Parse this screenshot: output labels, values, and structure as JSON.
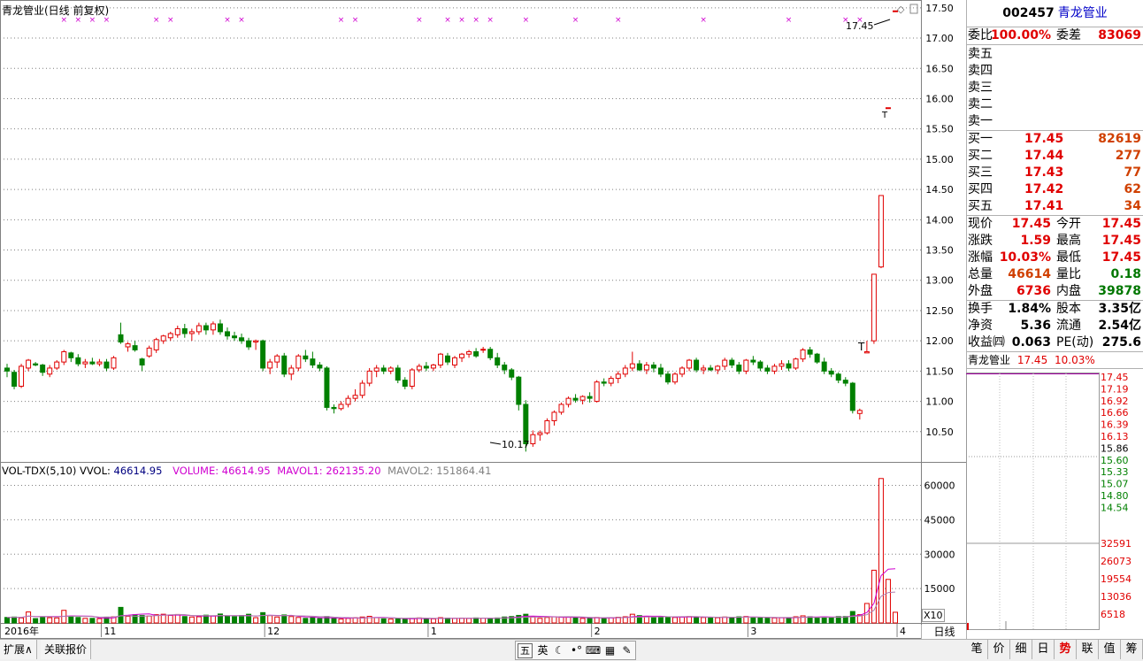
{
  "header": {
    "main_title": "青龙管业(日线 前复权)"
  },
  "volume_header": {
    "indicator": "VOL-TDX(5,10)",
    "vvol_label": "VVOL:",
    "vvol_value": "46614.95",
    "volume_text": "VOLUME: 46614.95",
    "mavol1_text": "MAVOL1: 262135.20",
    "mavol2_text": "MAVOL2: 151864.41"
  },
  "price_axis": {
    "ticks": [
      "17.50",
      "17.00",
      "16.50",
      "16.00",
      "15.50",
      "15.00",
      "14.50",
      "14.00",
      "13.50",
      "13.00",
      "12.50",
      "12.00",
      "11.50",
      "11.00",
      "10.50"
    ]
  },
  "vol_axis": {
    "ticks": [
      "60000",
      "45000",
      "30000",
      "15000"
    ],
    "unit": "X10"
  },
  "date_axis": {
    "labels": [
      "2016年",
      "11",
      "12",
      "1",
      "2",
      "3",
      "4"
    ]
  },
  "annotations": {
    "high": "17.45",
    "low": "10.17"
  },
  "colors": {
    "up": "#e00000",
    "down": "#008000",
    "ma1": "#d000d0",
    "ma2": "#b080b0",
    "grid": "#7f7f7f"
  },
  "chart_data": {
    "type": "candlestick",
    "price_ylim": [
      10.0,
      17.6
    ],
    "volume_ylim": [
      0,
      66000
    ],
    "candles": [
      [
        11.55,
        11.62,
        11.4,
        11.5,
        2400
      ],
      [
        11.48,
        11.52,
        11.2,
        11.25,
        2600
      ],
      [
        11.25,
        11.62,
        11.22,
        11.58,
        2200
      ],
      [
        11.55,
        11.7,
        11.5,
        11.68,
        4800
      ],
      [
        11.62,
        11.65,
        11.58,
        11.6,
        1900
      ],
      [
        11.6,
        11.62,
        11.42,
        11.48,
        2600
      ],
      [
        11.45,
        11.6,
        11.4,
        11.55,
        2300
      ],
      [
        11.55,
        11.68,
        11.52,
        11.65,
        2200
      ],
      [
        11.65,
        11.85,
        11.6,
        11.82,
        5500
      ],
      [
        11.8,
        11.82,
        11.65,
        11.72,
        2800
      ],
      [
        11.72,
        11.78,
        11.58,
        11.62,
        2400
      ],
      [
        11.62,
        11.7,
        11.55,
        11.65,
        2000
      ],
      [
        11.65,
        11.72,
        11.6,
        11.62,
        2000
      ],
      [
        11.62,
        11.7,
        11.58,
        11.65,
        1900
      ],
      [
        11.65,
        11.7,
        11.5,
        11.55,
        2400
      ],
      [
        11.55,
        11.75,
        11.52,
        11.72,
        2700
      ],
      [
        12.1,
        12.3,
        11.95,
        11.98,
        6800
      ],
      [
        11.9,
        11.98,
        11.82,
        11.95,
        2900
      ],
      [
        11.92,
        12.0,
        11.82,
        11.85,
        3600
      ],
      [
        11.7,
        11.72,
        11.5,
        11.6,
        3300
      ],
      [
        11.75,
        11.92,
        11.72,
        11.88,
        3000
      ],
      [
        11.85,
        12.05,
        11.8,
        12.02,
        3600
      ],
      [
        12.0,
        12.1,
        11.95,
        12.08,
        3800
      ],
      [
        12.05,
        12.15,
        12.0,
        12.12,
        3300
      ],
      [
        12.1,
        12.25,
        12.05,
        12.2,
        3700
      ],
      [
        12.2,
        12.28,
        12.05,
        12.12,
        2800
      ],
      [
        12.12,
        12.2,
        12.0,
        12.15,
        2600
      ],
      [
        12.15,
        12.3,
        12.1,
        12.25,
        2700
      ],
      [
        12.25,
        12.3,
        12.1,
        12.18,
        3400
      ],
      [
        12.18,
        12.32,
        12.1,
        12.28,
        3100
      ],
      [
        12.28,
        12.35,
        12.1,
        12.15,
        3900
      ],
      [
        12.15,
        12.22,
        12.02,
        12.08,
        2900
      ],
      [
        12.08,
        12.15,
        12.0,
        12.05,
        2700
      ],
      [
        12.05,
        12.12,
        11.95,
        12.0,
        3200
      ],
      [
        12.0,
        12.05,
        11.85,
        11.9,
        3800
      ],
      [
        11.98,
        12.02,
        11.85,
        12.0,
        2300
      ],
      [
        12.0,
        12.02,
        11.5,
        11.55,
        4500
      ],
      [
        11.55,
        11.7,
        11.45,
        11.65,
        3200
      ],
      [
        11.65,
        11.78,
        11.55,
        11.75,
        2600
      ],
      [
        11.75,
        11.8,
        11.4,
        11.45,
        3500
      ],
      [
        11.45,
        11.6,
        11.35,
        11.55,
        2800
      ],
      [
        11.55,
        11.78,
        11.5,
        11.75,
        2400
      ],
      [
        11.75,
        11.85,
        11.65,
        11.7,
        2000
      ],
      [
        11.7,
        11.82,
        11.55,
        11.6,
        2300
      ],
      [
        11.6,
        11.65,
        11.5,
        11.55,
        1900
      ],
      [
        11.55,
        11.58,
        10.85,
        10.9,
        2800
      ],
      [
        10.9,
        10.95,
        10.8,
        10.88,
        2100
      ],
      [
        10.88,
        11.0,
        10.85,
        10.95,
        1700
      ],
      [
        10.95,
        11.1,
        10.9,
        11.05,
        2000
      ],
      [
        11.05,
        11.2,
        11.0,
        11.1,
        2300
      ],
      [
        11.1,
        11.35,
        11.05,
        11.3,
        2600
      ],
      [
        11.3,
        11.55,
        11.25,
        11.5,
        2900
      ],
      [
        11.5,
        11.6,
        11.4,
        11.55,
        2300
      ],
      [
        11.55,
        11.6,
        11.45,
        11.5,
        1800
      ],
      [
        11.5,
        11.58,
        11.45,
        11.55,
        1700
      ],
      [
        11.55,
        11.6,
        11.3,
        11.35,
        1900
      ],
      [
        11.35,
        11.4,
        11.2,
        11.25,
        1700
      ],
      [
        11.25,
        11.55,
        11.2,
        11.52,
        2100
      ],
      [
        11.52,
        11.62,
        11.48,
        11.58,
        2200
      ],
      [
        11.58,
        11.65,
        11.5,
        11.55,
        1900
      ],
      [
        11.55,
        11.62,
        11.5,
        11.6,
        1800
      ],
      [
        11.6,
        11.8,
        11.55,
        11.78,
        2300
      ],
      [
        11.75,
        11.8,
        11.6,
        11.65,
        2100
      ],
      [
        11.6,
        11.75,
        11.55,
        11.72,
        2000
      ],
      [
        11.72,
        11.8,
        11.65,
        11.78,
        2100
      ],
      [
        11.78,
        11.85,
        11.72,
        11.82,
        2000
      ],
      [
        11.82,
        11.88,
        11.72,
        11.75,
        2200
      ],
      [
        11.85,
        11.9,
        11.8,
        11.86,
        2100
      ],
      [
        11.86,
        11.9,
        11.68,
        11.72,
        2000
      ],
      [
        11.72,
        11.8,
        11.55,
        11.6,
        2200
      ],
      [
        11.6,
        11.65,
        11.45,
        11.52,
        2600
      ],
      [
        11.52,
        11.55,
        11.35,
        11.4,
        2800
      ],
      [
        11.4,
        11.42,
        10.85,
        10.95,
        3300
      ],
      [
        10.95,
        11.02,
        10.17,
        10.3,
        3800
      ],
      [
        10.3,
        10.52,
        10.25,
        10.45,
        2600
      ],
      [
        10.45,
        10.52,
        10.35,
        10.48,
        2000
      ],
      [
        10.48,
        10.72,
        10.45,
        10.68,
        2400
      ],
      [
        10.68,
        10.85,
        10.6,
        10.82,
        2700
      ],
      [
        10.82,
        10.98,
        10.78,
        10.95,
        2700
      ],
      [
        10.95,
        11.08,
        10.9,
        11.05,
        2500
      ],
      [
        11.05,
        11.12,
        10.98,
        11.02,
        2200
      ],
      [
        11.02,
        11.1,
        10.95,
        11.08,
        2000
      ],
      [
        11.08,
        11.15,
        10.98,
        11.05,
        1900
      ],
      [
        11.0,
        11.35,
        10.98,
        11.32,
        2400
      ],
      [
        11.32,
        11.38,
        11.25,
        11.3,
        2300
      ],
      [
        11.3,
        11.42,
        11.25,
        11.38,
        2300
      ],
      [
        11.38,
        11.5,
        11.3,
        11.45,
        2500
      ],
      [
        11.45,
        11.6,
        11.4,
        11.55,
        2700
      ],
      [
        11.55,
        11.82,
        11.5,
        11.62,
        3800
      ],
      [
        11.62,
        11.68,
        11.5,
        11.52,
        3200
      ],
      [
        11.52,
        11.65,
        11.45,
        11.6,
        2700
      ],
      [
        11.6,
        11.65,
        11.48,
        11.55,
        2300
      ],
      [
        11.55,
        11.62,
        11.4,
        11.45,
        2600
      ],
      [
        11.45,
        11.5,
        11.28,
        11.32,
        2700
      ],
      [
        11.32,
        11.48,
        11.28,
        11.45,
        2400
      ],
      [
        11.45,
        11.58,
        11.4,
        11.55,
        2600
      ],
      [
        11.55,
        11.7,
        11.5,
        11.68,
        2800
      ],
      [
        11.68,
        11.72,
        11.48,
        11.52,
        2700
      ],
      [
        11.52,
        11.6,
        11.45,
        11.55,
        2400
      ],
      [
        11.55,
        11.6,
        11.5,
        11.52,
        2200
      ],
      [
        11.52,
        11.6,
        11.45,
        11.58,
        2300
      ],
      [
        11.58,
        11.72,
        11.52,
        11.68,
        2600
      ],
      [
        11.68,
        11.72,
        11.55,
        11.6,
        2500
      ],
      [
        11.6,
        11.65,
        11.45,
        11.5,
        2700
      ],
      [
        11.5,
        11.7,
        11.45,
        11.68,
        2800
      ],
      [
        11.68,
        11.75,
        11.6,
        11.65,
        2400
      ],
      [
        11.65,
        11.68,
        11.5,
        11.55,
        2300
      ],
      [
        11.55,
        11.6,
        11.45,
        11.5,
        2100
      ],
      [
        11.5,
        11.62,
        11.45,
        11.58,
        2200
      ],
      [
        11.58,
        11.68,
        11.52,
        11.62,
        2300
      ],
      [
        11.62,
        11.68,
        11.5,
        11.55,
        2200
      ],
      [
        11.55,
        11.72,
        11.52,
        11.7,
        2700
      ],
      [
        11.7,
        11.88,
        11.65,
        11.85,
        3100
      ],
      [
        11.85,
        11.9,
        11.72,
        11.78,
        2700
      ],
      [
        11.78,
        11.8,
        11.62,
        11.65,
        2400
      ],
      [
        11.65,
        11.72,
        11.45,
        11.5,
        2600
      ],
      [
        11.5,
        11.55,
        11.4,
        11.45,
        2300
      ],
      [
        11.45,
        11.48,
        11.3,
        11.35,
        2800
      ],
      [
        11.35,
        11.4,
        11.25,
        11.3,
        2800
      ],
      [
        11.3,
        11.32,
        10.8,
        10.85,
        5000
      ],
      [
        10.8,
        10.88,
        10.7,
        10.85,
        3600
      ],
      [
        11.8,
        12.0,
        11.8,
        11.82,
        8500
      ],
      [
        12.0,
        13.1,
        11.95,
        13.1,
        23000
      ],
      [
        13.22,
        14.4,
        13.2,
        14.4,
        63000
      ],
      [
        15.85,
        15.85,
        15.85,
        15.85,
        19000
      ],
      [
        17.45,
        17.45,
        17.45,
        17.45,
        4661
      ]
    ]
  }
}
